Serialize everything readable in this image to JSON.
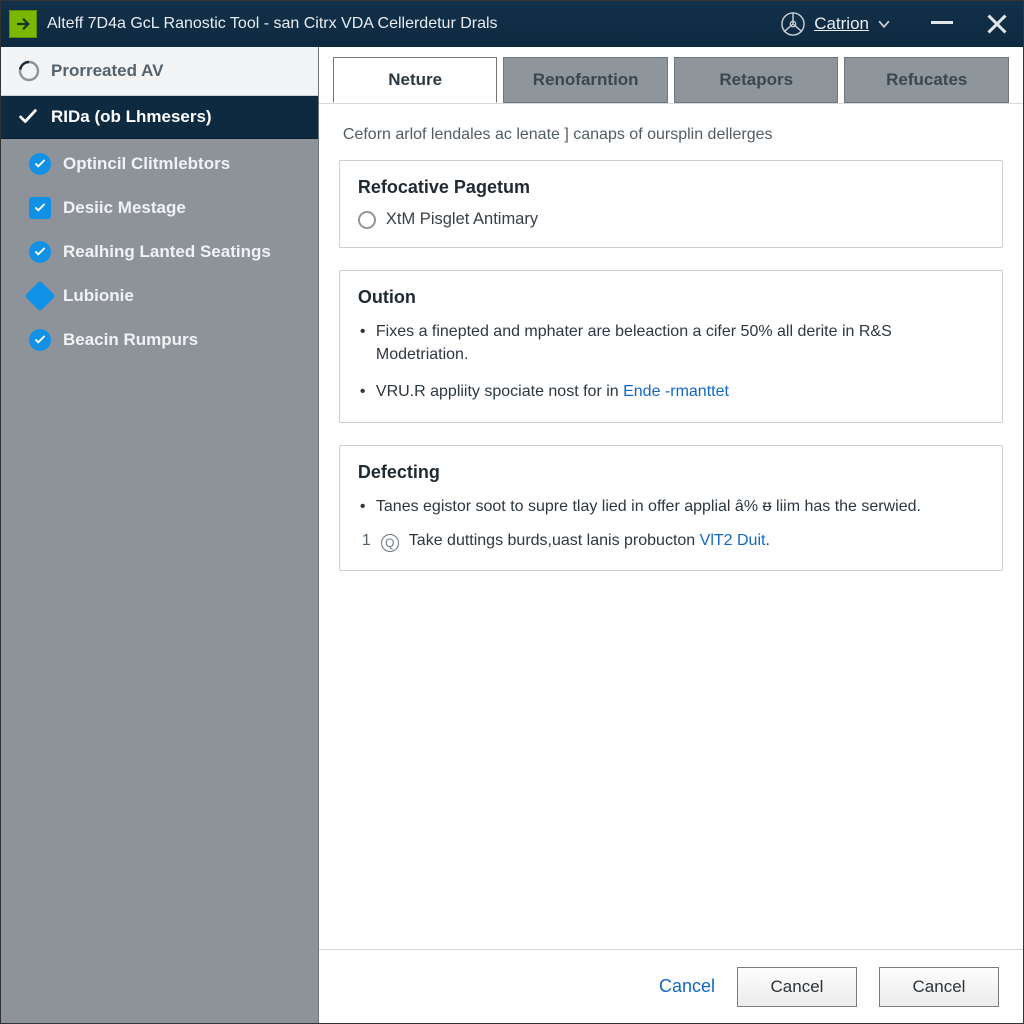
{
  "titlebar": {
    "title": "Alteff 7D4a GcL Ranostic Tool - san Citrx VDA Cellerdetur Drals",
    "brand": "Catrion"
  },
  "sidebar": {
    "top_label": "Prorreated AV",
    "selected_label": "RIDa (ob Lhmesers)",
    "items": [
      {
        "label": "Optincil Clitmlebtors",
        "icon": "check-round"
      },
      {
        "label": "Desiic Mestage",
        "icon": "check-square"
      },
      {
        "label": "Realhing Lanted Seatings",
        "icon": "check-round"
      },
      {
        "label": "Lubionie",
        "icon": "cube"
      },
      {
        "label": "Beacin Rumpurs",
        "icon": "check-round"
      }
    ]
  },
  "tabs": [
    {
      "label": "Neture",
      "active": true
    },
    {
      "label": "Renofarntion",
      "active": false
    },
    {
      "label": "Retapors",
      "active": false
    },
    {
      "label": "Refucates",
      "active": false
    }
  ],
  "content": {
    "intro": "Ceforn arlof lendales ac lenate ] canaps of oursplin dellerges",
    "panel1": {
      "heading": "Refocative Pagetum",
      "radio_label": "XtM Pisglet Antimary"
    },
    "panel2": {
      "heading": "Oution",
      "bullets": [
        {
          "text_a": "Fixes a finepted and mphater are beleaction a cifer 50% all derite in R&S Modetriation."
        },
        {
          "text_a": "VRU.R appliity spociate nost for in ",
          "link": "Ende -rmanttet"
        }
      ]
    },
    "panel3": {
      "heading": "Defecting",
      "bullets": [
        {
          "text_a": "Tanes egistor soot to supre tlay lied in offer applial ȃ% ᵿ liim has the serwied."
        }
      ],
      "num_idx": "1",
      "num_text_a": "Take duttings burds,uast lanis probucton ",
      "num_link": "VlT2 Duit",
      "num_dot": "."
    }
  },
  "footer": {
    "link": "Cancel",
    "btn1": "Cancel",
    "btn2": "Cancel"
  }
}
